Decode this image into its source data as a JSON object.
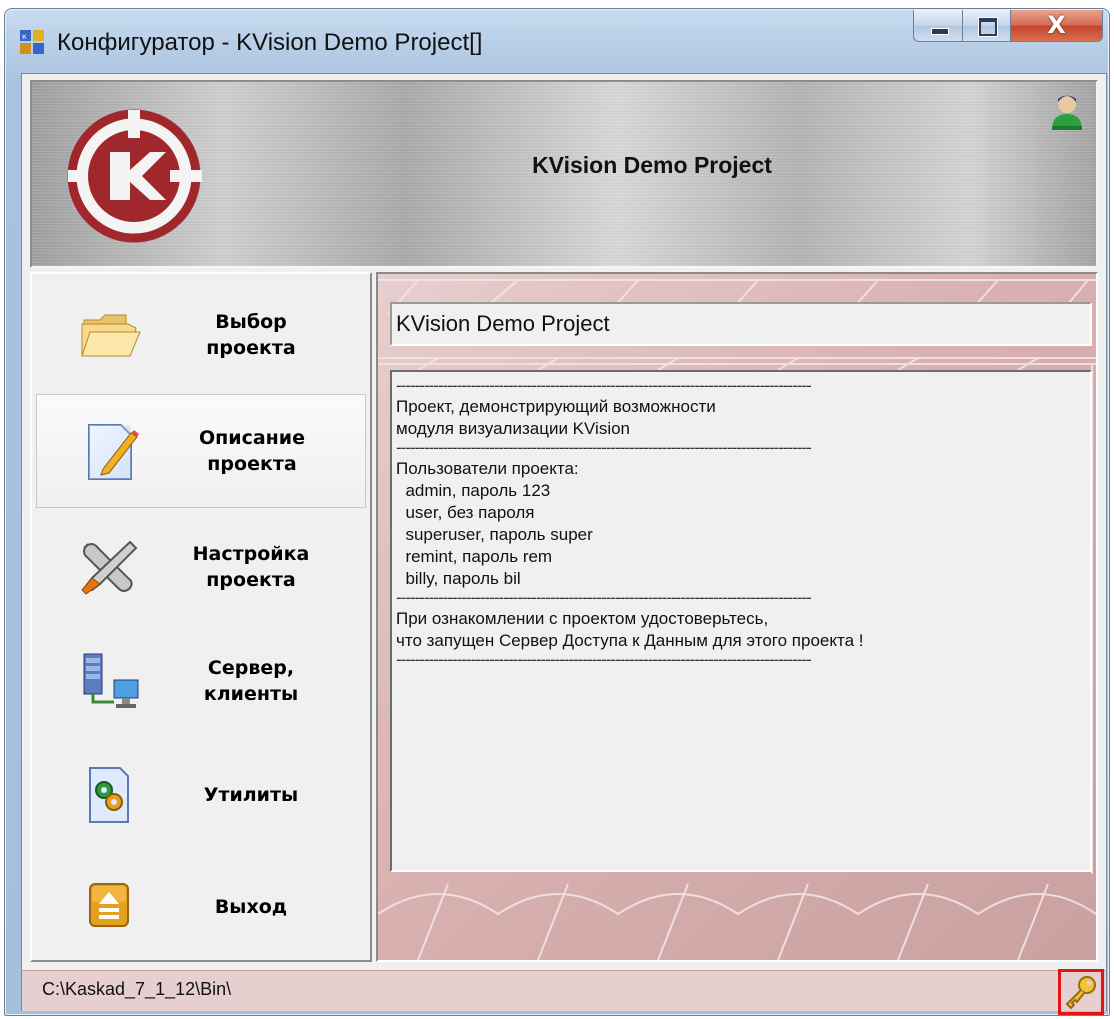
{
  "window": {
    "title": "Конфигуратор - KVision Demo Project[]",
    "close_label": "X"
  },
  "header": {
    "title": "KVision Demo Project"
  },
  "sidebar": {
    "items": [
      {
        "label": "Выбор\nпроекта",
        "icon": "folder-icon",
        "active": false
      },
      {
        "label": "Описание\nпроекта",
        "icon": "document-edit-icon",
        "active": true
      },
      {
        "label": "Настройка\nпроекта",
        "icon": "tools-icon",
        "active": false
      },
      {
        "label": "Сервер,\nклиенты",
        "icon": "server-network-icon",
        "active": false
      },
      {
        "label": "Утилиты",
        "icon": "utilities-icon",
        "active": false
      },
      {
        "label": "Выход",
        "icon": "exit-icon",
        "active": false
      }
    ]
  },
  "main": {
    "project_name": "KVision Demo Project",
    "description_lines": [
      "-----------------------------------------------------------------------------------------",
      "Проект, демонстрирующий возможности",
      "модуля визуализации KVision",
      "-----------------------------------------------------------------------------------------",
      "Пользователи проекта:",
      "  admin, пароль 123",
      "  user, без пароля",
      "  superuser, пароль super",
      "  remint, пароль rem",
      "  billy, пароль bil",
      "-----------------------------------------------------------------------------------------",
      "При ознакомлении с проектом удостоверьтесь,",
      "что запущен Сервер Доступа к Данным для этого проекта !",
      "-----------------------------------------------------------------------------------------"
    ]
  },
  "status": {
    "path": "C:\\Kaskad_7_1_12\\Bin\\"
  },
  "colors": {
    "accent_red": "#a0282c",
    "highlight_border": "#e01515",
    "panel_pink": "#d9b1b1"
  }
}
